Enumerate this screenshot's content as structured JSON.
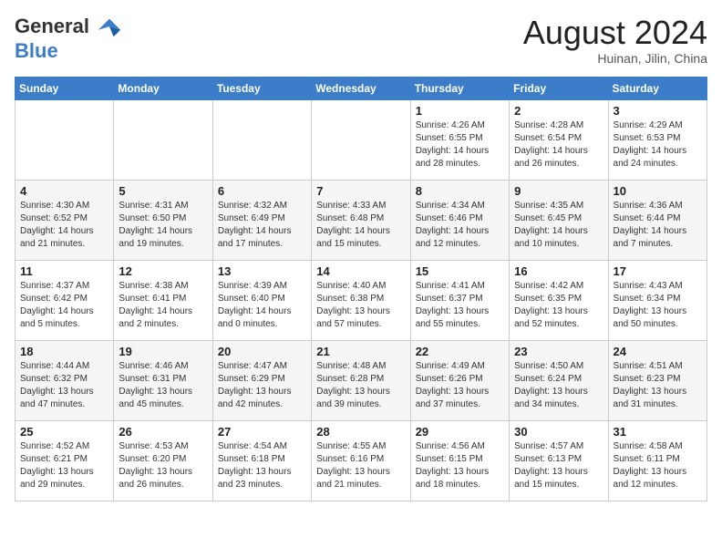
{
  "header": {
    "logo_line1": "General",
    "logo_line2": "Blue",
    "month": "August 2024",
    "location": "Huinan, Jilin, China"
  },
  "weekdays": [
    "Sunday",
    "Monday",
    "Tuesday",
    "Wednesday",
    "Thursday",
    "Friday",
    "Saturday"
  ],
  "weeks": [
    [
      {
        "day": "",
        "info": ""
      },
      {
        "day": "",
        "info": ""
      },
      {
        "day": "",
        "info": ""
      },
      {
        "day": "",
        "info": ""
      },
      {
        "day": "1",
        "info": "Sunrise: 4:26 AM\nSunset: 6:55 PM\nDaylight: 14 hours\nand 28 minutes."
      },
      {
        "day": "2",
        "info": "Sunrise: 4:28 AM\nSunset: 6:54 PM\nDaylight: 14 hours\nand 26 minutes."
      },
      {
        "day": "3",
        "info": "Sunrise: 4:29 AM\nSunset: 6:53 PM\nDaylight: 14 hours\nand 24 minutes."
      }
    ],
    [
      {
        "day": "4",
        "info": "Sunrise: 4:30 AM\nSunset: 6:52 PM\nDaylight: 14 hours\nand 21 minutes."
      },
      {
        "day": "5",
        "info": "Sunrise: 4:31 AM\nSunset: 6:50 PM\nDaylight: 14 hours\nand 19 minutes."
      },
      {
        "day": "6",
        "info": "Sunrise: 4:32 AM\nSunset: 6:49 PM\nDaylight: 14 hours\nand 17 minutes."
      },
      {
        "day": "7",
        "info": "Sunrise: 4:33 AM\nSunset: 6:48 PM\nDaylight: 14 hours\nand 15 minutes."
      },
      {
        "day": "8",
        "info": "Sunrise: 4:34 AM\nSunset: 6:46 PM\nDaylight: 14 hours\nand 12 minutes."
      },
      {
        "day": "9",
        "info": "Sunrise: 4:35 AM\nSunset: 6:45 PM\nDaylight: 14 hours\nand 10 minutes."
      },
      {
        "day": "10",
        "info": "Sunrise: 4:36 AM\nSunset: 6:44 PM\nDaylight: 14 hours\nand 7 minutes."
      }
    ],
    [
      {
        "day": "11",
        "info": "Sunrise: 4:37 AM\nSunset: 6:42 PM\nDaylight: 14 hours\nand 5 minutes."
      },
      {
        "day": "12",
        "info": "Sunrise: 4:38 AM\nSunset: 6:41 PM\nDaylight: 14 hours\nand 2 minutes."
      },
      {
        "day": "13",
        "info": "Sunrise: 4:39 AM\nSunset: 6:40 PM\nDaylight: 14 hours\nand 0 minutes."
      },
      {
        "day": "14",
        "info": "Sunrise: 4:40 AM\nSunset: 6:38 PM\nDaylight: 13 hours\nand 57 minutes."
      },
      {
        "day": "15",
        "info": "Sunrise: 4:41 AM\nSunset: 6:37 PM\nDaylight: 13 hours\nand 55 minutes."
      },
      {
        "day": "16",
        "info": "Sunrise: 4:42 AM\nSunset: 6:35 PM\nDaylight: 13 hours\nand 52 minutes."
      },
      {
        "day": "17",
        "info": "Sunrise: 4:43 AM\nSunset: 6:34 PM\nDaylight: 13 hours\nand 50 minutes."
      }
    ],
    [
      {
        "day": "18",
        "info": "Sunrise: 4:44 AM\nSunset: 6:32 PM\nDaylight: 13 hours\nand 47 minutes."
      },
      {
        "day": "19",
        "info": "Sunrise: 4:46 AM\nSunset: 6:31 PM\nDaylight: 13 hours\nand 45 minutes."
      },
      {
        "day": "20",
        "info": "Sunrise: 4:47 AM\nSunset: 6:29 PM\nDaylight: 13 hours\nand 42 minutes."
      },
      {
        "day": "21",
        "info": "Sunrise: 4:48 AM\nSunset: 6:28 PM\nDaylight: 13 hours\nand 39 minutes."
      },
      {
        "day": "22",
        "info": "Sunrise: 4:49 AM\nSunset: 6:26 PM\nDaylight: 13 hours\nand 37 minutes."
      },
      {
        "day": "23",
        "info": "Sunrise: 4:50 AM\nSunset: 6:24 PM\nDaylight: 13 hours\nand 34 minutes."
      },
      {
        "day": "24",
        "info": "Sunrise: 4:51 AM\nSunset: 6:23 PM\nDaylight: 13 hours\nand 31 minutes."
      }
    ],
    [
      {
        "day": "25",
        "info": "Sunrise: 4:52 AM\nSunset: 6:21 PM\nDaylight: 13 hours\nand 29 minutes."
      },
      {
        "day": "26",
        "info": "Sunrise: 4:53 AM\nSunset: 6:20 PM\nDaylight: 13 hours\nand 26 minutes."
      },
      {
        "day": "27",
        "info": "Sunrise: 4:54 AM\nSunset: 6:18 PM\nDaylight: 13 hours\nand 23 minutes."
      },
      {
        "day": "28",
        "info": "Sunrise: 4:55 AM\nSunset: 6:16 PM\nDaylight: 13 hours\nand 21 minutes."
      },
      {
        "day": "29",
        "info": "Sunrise: 4:56 AM\nSunset: 6:15 PM\nDaylight: 13 hours\nand 18 minutes."
      },
      {
        "day": "30",
        "info": "Sunrise: 4:57 AM\nSunset: 6:13 PM\nDaylight: 13 hours\nand 15 minutes."
      },
      {
        "day": "31",
        "info": "Sunrise: 4:58 AM\nSunset: 6:11 PM\nDaylight: 13 hours\nand 12 minutes."
      }
    ]
  ]
}
